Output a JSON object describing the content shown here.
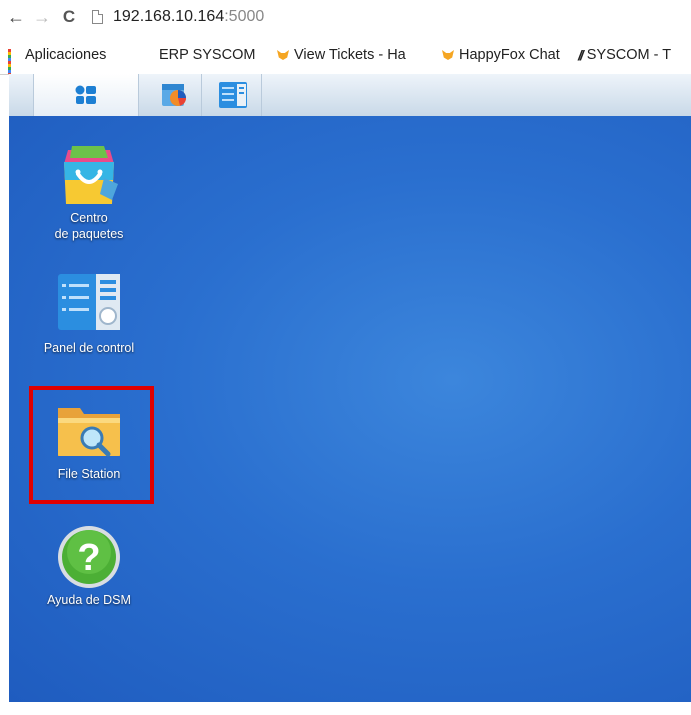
{
  "browser": {
    "url_host": "192.168.10.164",
    "url_port": ":5000",
    "nav": {
      "back_icon": "←",
      "forward_icon": "→",
      "reload_icon": "C"
    },
    "bookmarks": [
      {
        "label": "Aplicaciones",
        "icon": "apps-grid-icon"
      },
      {
        "label": "ERP SYSCOM",
        "icon": ""
      },
      {
        "label": "View Tickets - Ha",
        "icon": "happyfox-icon"
      },
      {
        "label": "HappyFox Chat",
        "icon": "happyfox-icon"
      },
      {
        "label": "SYSCOM - T",
        "icon": "syscom-icon"
      }
    ]
  },
  "taskbar": {
    "buttons": [
      {
        "name": "main-menu",
        "icon": "main-menu-icon"
      },
      {
        "name": "package-center",
        "icon": "package-center-icon"
      },
      {
        "name": "control-panel",
        "icon": "control-panel-icon"
      }
    ]
  },
  "desktop": {
    "icons": [
      {
        "label": "Centro\nde paquetes",
        "icon": "package-center-icon"
      },
      {
        "label": "Panel de control",
        "icon": "control-panel-icon"
      },
      {
        "label": "File Station",
        "icon": "file-station-icon"
      },
      {
        "label": "Ayuda de DSM",
        "icon": "help-icon"
      }
    ],
    "highlighted": "File Station",
    "colors": {
      "wallpaper": "#2a6fcf",
      "highlight": "#e00000"
    }
  }
}
